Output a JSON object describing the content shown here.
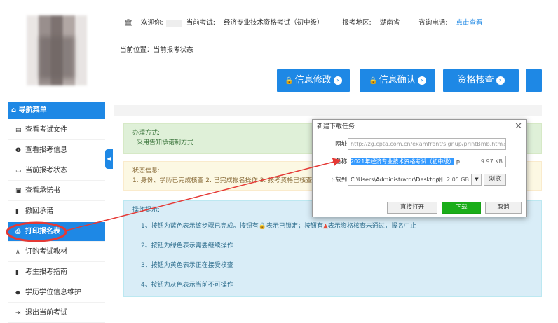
{
  "header": {
    "welcome": "欢迎你:",
    "current_exam_label": "当前考试:",
    "current_exam": "经济专业技术资格考试（初中级）",
    "region_label": "报考地区:",
    "region": "湖南省",
    "phone_label": "咨询电话:",
    "phone_link": "点击查看"
  },
  "breadcrumb": "当前位置：当前报考状态",
  "sidebar": {
    "header": "导航菜单",
    "items": [
      {
        "label": "查看考试文件",
        "icon": "file-icon"
      },
      {
        "label": "查看报考信息",
        "icon": "info-icon"
      },
      {
        "label": "当前报考状态",
        "icon": "monitor-icon"
      },
      {
        "label": "查看承诺书",
        "icon": "id-card-icon"
      },
      {
        "label": "撤回承诺",
        "icon": "book-icon"
      },
      {
        "label": "打印报名表",
        "icon": "print-icon"
      },
      {
        "label": "订购考试教材",
        "icon": "cart-icon"
      },
      {
        "label": "考生报考指南",
        "icon": "guide-icon"
      },
      {
        "label": "学历学位信息维护",
        "icon": "graduation-cap-icon"
      },
      {
        "label": "退出当前考试",
        "icon": "exit-icon"
      }
    ]
  },
  "actions": {
    "info_edit": "信息修改",
    "info_confirm": "信息确认",
    "qual_check": "资格核查"
  },
  "notices": {
    "method_title": "办理方式:",
    "method_text": "采用告知承诺制方式",
    "status_title": "状态信息:",
    "status_text": "1. 身份、学历已完成核查 2. 已完成报名操作 3. 报考资格已核查",
    "tips_title": "操作提示:",
    "tip1": "1、按钮为蓝色表示该步骤已完成。按钮有",
    "tip1b": "表示已锁定；按钮有",
    "tip1c": "表示资格核查未通过，报名中止",
    "tip2": "2、按钮为绿色表示需要继续操作",
    "tip3": "3、按钮为黄色表示正在接受核查",
    "tip4": "4、按钮为灰色表示当前不可操作"
  },
  "dialog": {
    "title": "新建下载任务",
    "url_label": "网址:",
    "url": "http://zg.cpta.com.cn/examfront/signup/printBmb.htm?myi",
    "name_label": "名称:",
    "name_selected": "2021年经济专业技术资格考试（初中级）",
    "name_ext": ".p",
    "size": "9.97 KB",
    "dest_label": "下载到:",
    "dest": "C:\\Users\\Administrator\\Desktop",
    "free": "剩: 2.05 GB",
    "browse": "浏览",
    "open_direct": "直接打开",
    "download": "下载",
    "cancel": "取消"
  },
  "colors": {
    "primary": "#1e88e5",
    "annotation": "#e53935",
    "download_green": "#1aad19"
  }
}
